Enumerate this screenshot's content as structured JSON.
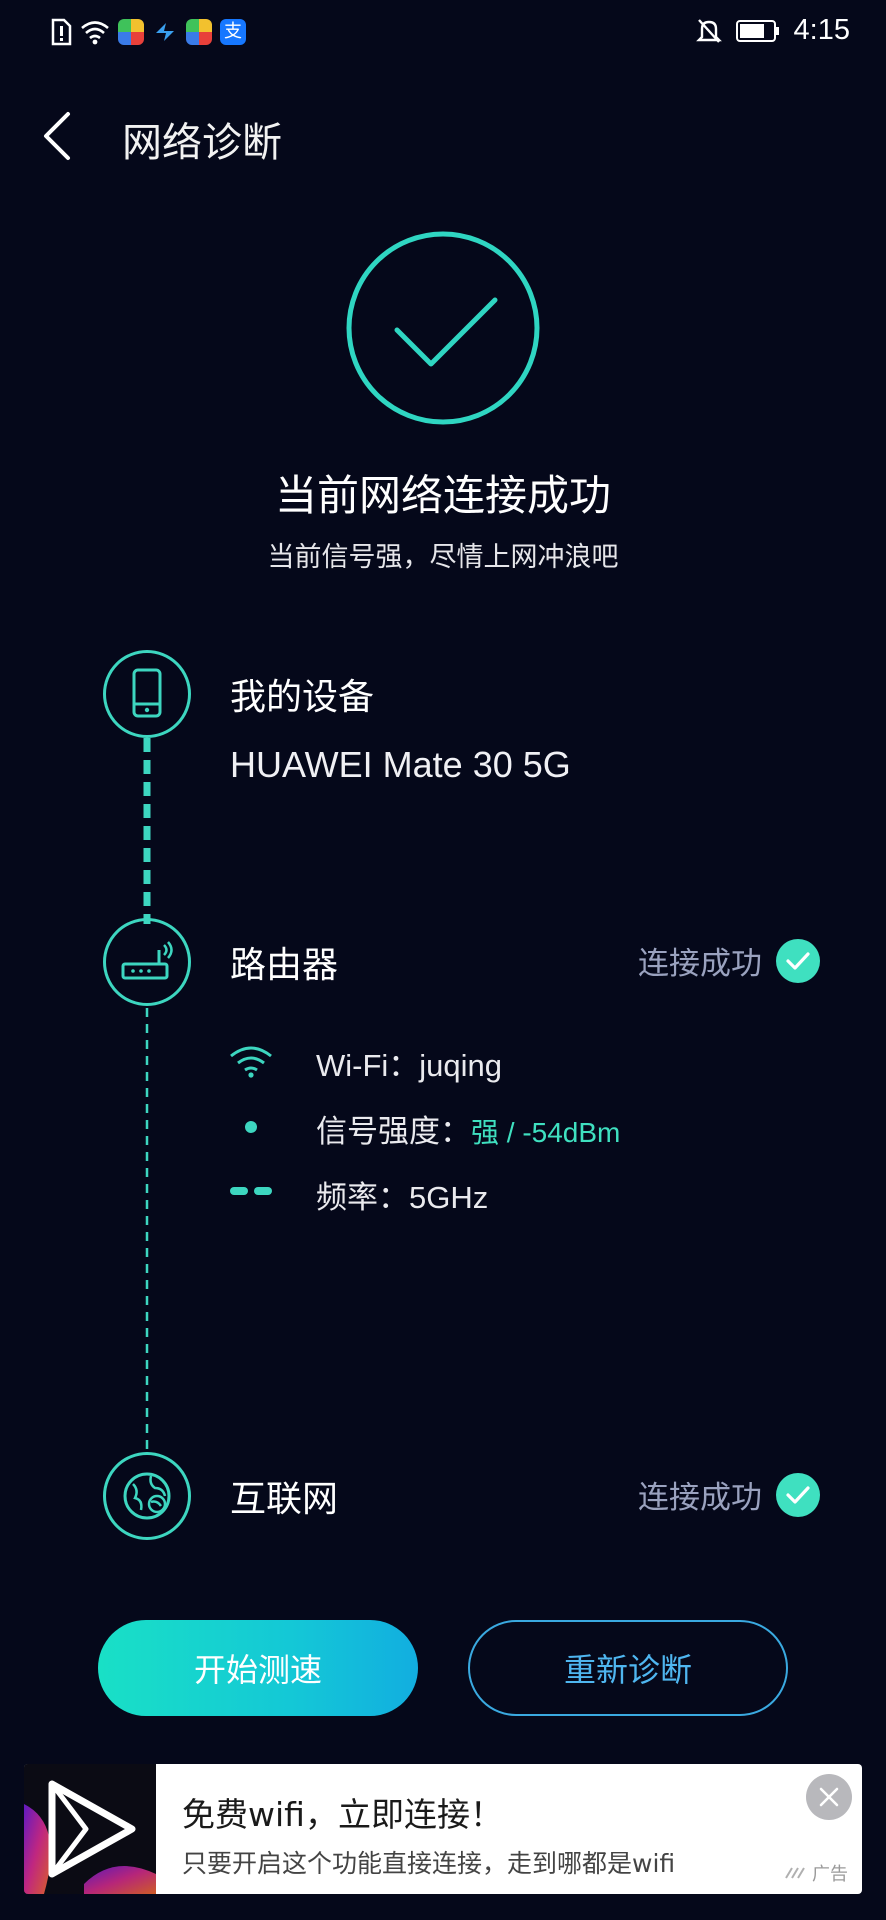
{
  "status_bar": {
    "time": "4:15",
    "icons": [
      "sim-alert-icon",
      "wifi-icon",
      "app-icon",
      "app-icon",
      "app-icon",
      "alipay-icon",
      "bell-off-icon",
      "battery-icon"
    ]
  },
  "header": {
    "title": "网络诊断",
    "back_icon": "chevron-left-icon"
  },
  "result": {
    "icon": "check-ring-icon",
    "title": "当前网络连接成功",
    "subtitle": "当前信号强，尽情上网冲浪吧"
  },
  "timeline": {
    "device": {
      "icon": "phone-icon",
      "label": "我的设备",
      "model": "HUAWEI Mate 30 5G"
    },
    "router": {
      "icon": "router-icon",
      "label": "路由器",
      "status": "连接成功",
      "details": {
        "wifi_label": "Wi-Fi：juqing",
        "signal_label": "信号强度：",
        "signal_value": "强 / -54dBm",
        "freq_label": "频率：5GHz"
      }
    },
    "internet": {
      "icon": "globe-icon",
      "label": "互联网",
      "status": "连接成功"
    }
  },
  "buttons": {
    "speed_test": "开始测速",
    "rediagnose": "重新诊断"
  },
  "ad": {
    "title": "免费wifi，立即连接！",
    "description": "只要开启这个功能直接连接，走到哪都是wifi",
    "tag": "广告"
  },
  "colors": {
    "background": "#05081a",
    "accent": "#3fe0c0",
    "secondary_accent": "#3aa9e0"
  }
}
